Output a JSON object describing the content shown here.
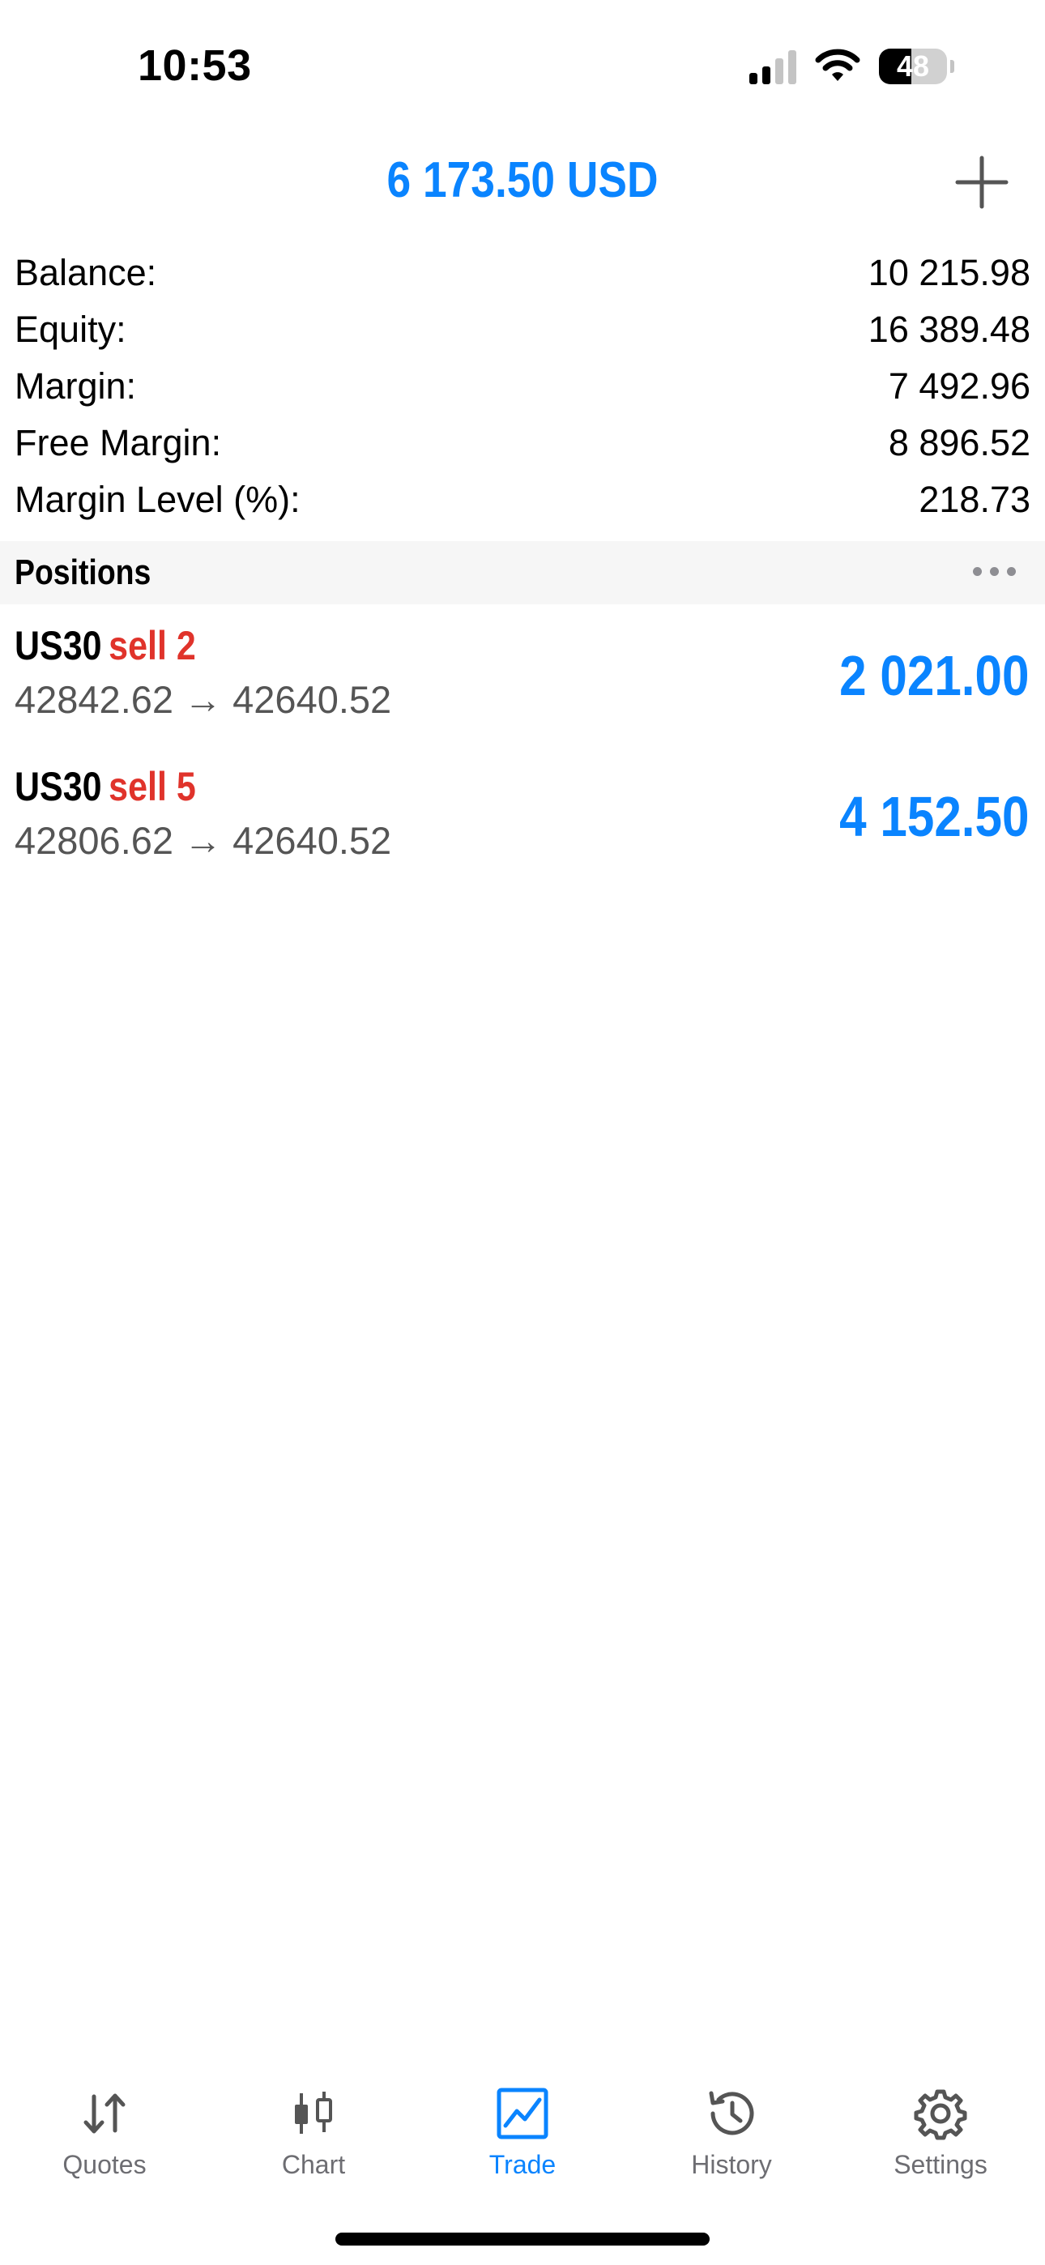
{
  "status_bar": {
    "time": "10:53",
    "battery": "48",
    "battery_level": 0.48,
    "icons": [
      "signal-icon",
      "wifi-icon",
      "battery-icon"
    ]
  },
  "header": {
    "title": "6 173.50 USD",
    "add_icon": "plus-icon"
  },
  "summary": [
    {
      "label": "Balance:",
      "value": "10 215.98"
    },
    {
      "label": "Equity:",
      "value": "16 389.48"
    },
    {
      "label": "Margin:",
      "value": "7 492.96"
    },
    {
      "label": "Free Margin:",
      "value": "8 896.52"
    },
    {
      "label": "Margin Level (%):",
      "value": "218.73"
    }
  ],
  "positions": {
    "title": "Positions",
    "more_icon": "more-icon",
    "items": [
      {
        "symbol": "US30",
        "side": "sell 2",
        "prices": "42842.62 → 42640.52",
        "profit": "2 021.00"
      },
      {
        "symbol": "US30",
        "side": "sell 5",
        "prices": "42806.62 → 42640.52",
        "profit": "4 152.50"
      }
    ]
  },
  "tabs": [
    {
      "label": "Quotes",
      "icon": "quotes-icon",
      "active": false
    },
    {
      "label": "Chart",
      "icon": "chart-icon",
      "active": false
    },
    {
      "label": "Trade",
      "icon": "trade-icon",
      "active": true
    },
    {
      "label": "History",
      "icon": "history-icon",
      "active": false
    },
    {
      "label": "Settings",
      "icon": "settings-icon",
      "active": false
    }
  ],
  "colors": {
    "accent": "#0a84ff",
    "sell": "#e0332b",
    "tab_inactive": "#6d6d72",
    "section_bg": "#f6f6f6"
  }
}
